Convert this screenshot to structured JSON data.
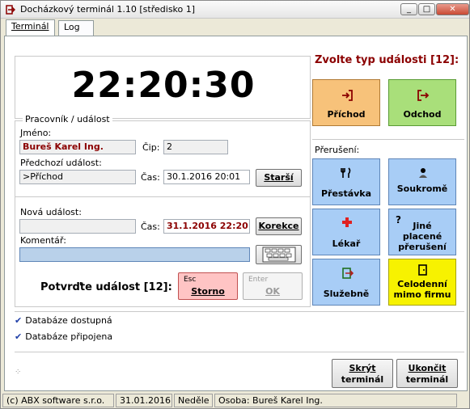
{
  "window": {
    "title": "Docházkový terminál 1.10 [středisko 1]",
    "minimize": "_",
    "maximize": "□",
    "close": "✕"
  },
  "tabs": [
    {
      "label": "Terminál"
    },
    {
      "label": "Log"
    }
  ],
  "clock": "22:20:30",
  "employee_group": {
    "legend": "Pracovník / událost",
    "name_label": "Jméno:",
    "name_value": "Bureš Karel Ing.",
    "chip_label": "Čip:",
    "chip_value": "2",
    "prev_event_label": "Předchozí událost:",
    "prev_event_value": ">Příchod",
    "prev_time_label": "Čas:",
    "prev_time_value": "30.1.2016 20:01",
    "older_button": "Starší",
    "new_event_label": "Nová událost:",
    "new_event_value": "",
    "new_time_label": "Čas:",
    "new_time_value": "31.1.2016 22:20",
    "correction_button": "Korekce",
    "comment_label": "Komentář:",
    "comment_value": "",
    "keyboard_icon": "keyboard-icon"
  },
  "confirm": {
    "text": "Potvrďte událost [12]:",
    "cancel_key": "Esc",
    "cancel_label": "Storno",
    "ok_key": "Enter",
    "ok_label": "OK"
  },
  "events": {
    "heading": "Zvolte typ události [12]:",
    "arrival": {
      "label": "Příchod",
      "icon": "enter-icon"
    },
    "departure": {
      "label": "Odchod",
      "icon": "exit-icon"
    },
    "interruption_label": "Přerušení:",
    "break": {
      "label": "Přestávka",
      "icon": "fork-knife-icon"
    },
    "private": {
      "label": "Soukromě",
      "icon": "person-icon"
    },
    "doctor": {
      "label": "Lékař",
      "icon": "red-cross-icon"
    },
    "other_paid": {
      "label_line1": "Jiné",
      "label_line2": "placené",
      "label_line3": "přerušení",
      "icon": "question-icon"
    },
    "business": {
      "label": "Služebně",
      "icon": "business-icon"
    },
    "whole_day": {
      "label_line1": "Celodenní",
      "label_line2": "mimo firmu",
      "icon": "door-icon"
    }
  },
  "status_checks": [
    {
      "label": "Databáze dostupná"
    },
    {
      "label": "Databáze připojena"
    }
  ],
  "bottom_buttons": {
    "hide_line1": "Skrýt",
    "hide_line2": "terminál",
    "quit_line1": "Ukončit",
    "quit_line2": "terminál"
  },
  "statusbar": {
    "company": "(c) ABX software s.r.o.",
    "date": "31.01.2016",
    "day": "Neděle",
    "person": "Osoba: Bureš Karel Ing."
  },
  "colors": {
    "arrival": "#f7c27a",
    "departure": "#a9df7a",
    "interruption": "#a8cdf6",
    "whole_day": "#f7f200",
    "heading": "#8b0000"
  }
}
